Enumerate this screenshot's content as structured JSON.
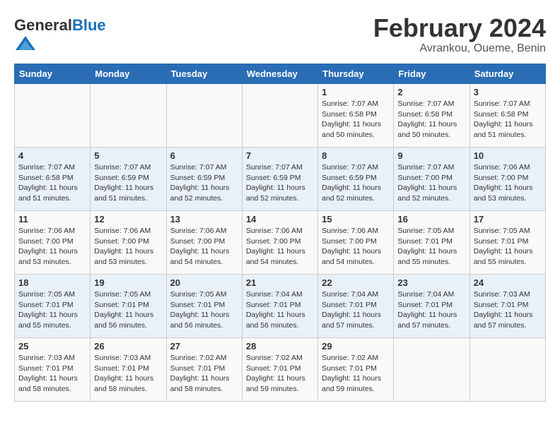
{
  "header": {
    "logo_general": "General",
    "logo_blue": "Blue",
    "title": "February 2024",
    "subtitle": "Avrankou, Oueme, Benin"
  },
  "days_of_week": [
    "Sunday",
    "Monday",
    "Tuesday",
    "Wednesday",
    "Thursday",
    "Friday",
    "Saturday"
  ],
  "weeks": [
    [
      {
        "day": "",
        "info": ""
      },
      {
        "day": "",
        "info": ""
      },
      {
        "day": "",
        "info": ""
      },
      {
        "day": "",
        "info": ""
      },
      {
        "day": "1",
        "info": "Sunrise: 7:07 AM\nSunset: 6:58 PM\nDaylight: 11 hours\nand 50 minutes."
      },
      {
        "day": "2",
        "info": "Sunrise: 7:07 AM\nSunset: 6:58 PM\nDaylight: 11 hours\nand 50 minutes."
      },
      {
        "day": "3",
        "info": "Sunrise: 7:07 AM\nSunset: 6:58 PM\nDaylight: 11 hours\nand 51 minutes."
      }
    ],
    [
      {
        "day": "4",
        "info": "Sunrise: 7:07 AM\nSunset: 6:58 PM\nDaylight: 11 hours\nand 51 minutes."
      },
      {
        "day": "5",
        "info": "Sunrise: 7:07 AM\nSunset: 6:59 PM\nDaylight: 11 hours\nand 51 minutes."
      },
      {
        "day": "6",
        "info": "Sunrise: 7:07 AM\nSunset: 6:59 PM\nDaylight: 11 hours\nand 52 minutes."
      },
      {
        "day": "7",
        "info": "Sunrise: 7:07 AM\nSunset: 6:59 PM\nDaylight: 11 hours\nand 52 minutes."
      },
      {
        "day": "8",
        "info": "Sunrise: 7:07 AM\nSunset: 6:59 PM\nDaylight: 11 hours\nand 52 minutes."
      },
      {
        "day": "9",
        "info": "Sunrise: 7:07 AM\nSunset: 7:00 PM\nDaylight: 11 hours\nand 52 minutes."
      },
      {
        "day": "10",
        "info": "Sunrise: 7:06 AM\nSunset: 7:00 PM\nDaylight: 11 hours\nand 53 minutes."
      }
    ],
    [
      {
        "day": "11",
        "info": "Sunrise: 7:06 AM\nSunset: 7:00 PM\nDaylight: 11 hours\nand 53 minutes."
      },
      {
        "day": "12",
        "info": "Sunrise: 7:06 AM\nSunset: 7:00 PM\nDaylight: 11 hours\nand 53 minutes."
      },
      {
        "day": "13",
        "info": "Sunrise: 7:06 AM\nSunset: 7:00 PM\nDaylight: 11 hours\nand 54 minutes."
      },
      {
        "day": "14",
        "info": "Sunrise: 7:06 AM\nSunset: 7:00 PM\nDaylight: 11 hours\nand 54 minutes."
      },
      {
        "day": "15",
        "info": "Sunrise: 7:06 AM\nSunset: 7:00 PM\nDaylight: 11 hours\nand 54 minutes."
      },
      {
        "day": "16",
        "info": "Sunrise: 7:05 AM\nSunset: 7:01 PM\nDaylight: 11 hours\nand 55 minutes."
      },
      {
        "day": "17",
        "info": "Sunrise: 7:05 AM\nSunset: 7:01 PM\nDaylight: 11 hours\nand 55 minutes."
      }
    ],
    [
      {
        "day": "18",
        "info": "Sunrise: 7:05 AM\nSunset: 7:01 PM\nDaylight: 11 hours\nand 55 minutes."
      },
      {
        "day": "19",
        "info": "Sunrise: 7:05 AM\nSunset: 7:01 PM\nDaylight: 11 hours\nand 56 minutes."
      },
      {
        "day": "20",
        "info": "Sunrise: 7:05 AM\nSunset: 7:01 PM\nDaylight: 11 hours\nand 56 minutes."
      },
      {
        "day": "21",
        "info": "Sunrise: 7:04 AM\nSunset: 7:01 PM\nDaylight: 11 hours\nand 56 minutes."
      },
      {
        "day": "22",
        "info": "Sunrise: 7:04 AM\nSunset: 7:01 PM\nDaylight: 11 hours\nand 57 minutes."
      },
      {
        "day": "23",
        "info": "Sunrise: 7:04 AM\nSunset: 7:01 PM\nDaylight: 11 hours\nand 57 minutes."
      },
      {
        "day": "24",
        "info": "Sunrise: 7:03 AM\nSunset: 7:01 PM\nDaylight: 11 hours\nand 57 minutes."
      }
    ],
    [
      {
        "day": "25",
        "info": "Sunrise: 7:03 AM\nSunset: 7:01 PM\nDaylight: 11 hours\nand 58 minutes."
      },
      {
        "day": "26",
        "info": "Sunrise: 7:03 AM\nSunset: 7:01 PM\nDaylight: 11 hours\nand 58 minutes."
      },
      {
        "day": "27",
        "info": "Sunrise: 7:02 AM\nSunset: 7:01 PM\nDaylight: 11 hours\nand 58 minutes."
      },
      {
        "day": "28",
        "info": "Sunrise: 7:02 AM\nSunset: 7:01 PM\nDaylight: 11 hours\nand 59 minutes."
      },
      {
        "day": "29",
        "info": "Sunrise: 7:02 AM\nSunset: 7:01 PM\nDaylight: 11 hours\nand 59 minutes."
      },
      {
        "day": "",
        "info": ""
      },
      {
        "day": "",
        "info": ""
      }
    ]
  ]
}
